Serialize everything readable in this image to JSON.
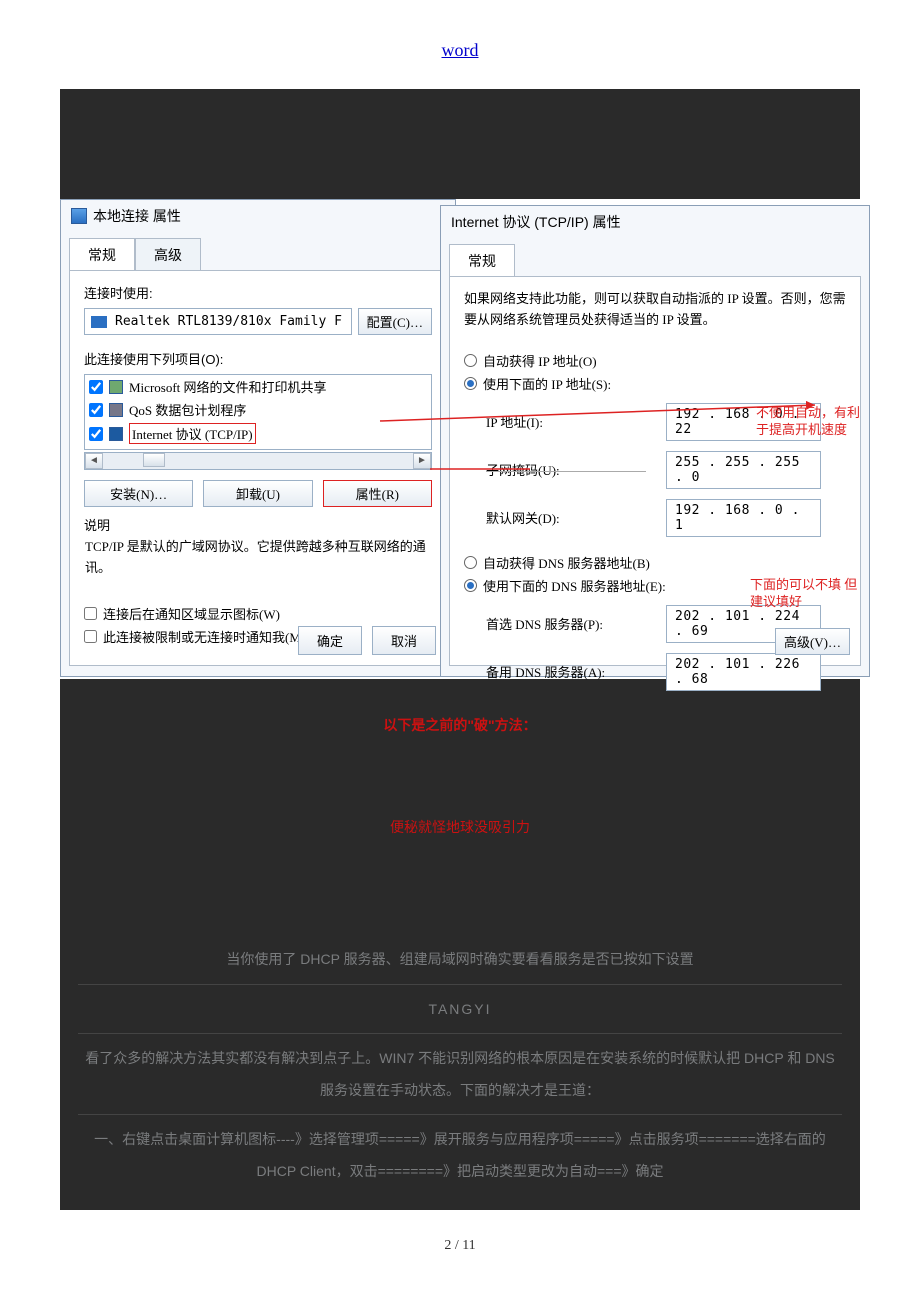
{
  "header": {
    "word_link": "word"
  },
  "dialog_left": {
    "title": "本地连接 属性",
    "tab_general": "常规",
    "tab_advanced": "高级",
    "connect_using": "连接时使用:",
    "adapter": "Realtek RTL8139/810x Family F",
    "configure_btn": "配置(C)…",
    "uses_items_label": "此连接使用下列项目(O):",
    "item1": "Microsoft 网络的文件和打印机共享",
    "item2": "QoS 数据包计划程序",
    "item3": "Internet 协议 (TCP/IP)",
    "install_btn": "安装(N)…",
    "uninstall_btn": "卸载(U)",
    "properties_btn": "属性(R)",
    "desc_label": "说明",
    "desc_text": "TCP/IP 是默认的广域网协议。它提供跨越多种互联网络的通讯。",
    "show_icon": "连接后在通知区域显示图标(W)",
    "notify_limited": "此连接被限制或无连接时通知我(M)",
    "ok_btn": "确定",
    "cancel_btn": "取消"
  },
  "dialog_right": {
    "title": "Internet 协议 (TCP/IP) 属性",
    "tab_general": "常规",
    "help_text": "如果网络支持此功能，则可以获取自动指派的 IP 设置。否则，您需要从网络系统管理员处获得适当的 IP 设置。",
    "auto_ip": "自动获得 IP 地址(O)",
    "use_ip": "使用下面的 IP 地址(S):",
    "ip_label": "IP 地址(I):",
    "ip_value": "192 . 168 .  0  . 22",
    "mask_label": "子网掩码(U):",
    "mask_value": "255 . 255 . 255 .  0",
    "gateway_label": "默认网关(D):",
    "gateway_value": "192 . 168 .  0  .  1",
    "auto_dns": "自动获得 DNS 服务器地址(B)",
    "use_dns": "使用下面的 DNS 服务器地址(E):",
    "dns1_label": "首选 DNS 服务器(P):",
    "dns1_value": "202 . 101 . 224 . 69",
    "dns2_label": "备用 DNS 服务器(A):",
    "dns2_value": "202 . 101 . 226 . 68",
    "advanced_btn": "高级(V)…",
    "anno_speed": "不使用自动，有利于提高开机速度",
    "anno_fill": "下面的可以不填 但建议填好"
  },
  "dark": {
    "heading": "以下是之前的\"破\"方法：",
    "red_quote": "便秘就怪地球没吸引力",
    "line_dhcp": "当你使用了 DHCP 服务器、组建局域网时确实要看看服务是否已按如下设置",
    "author": "TANGYI",
    "para1": "看了众多的解决方法其实都没有解决到点子上。WIN7 不能识别网络的根本原因是在安装系统的时候默认把 DHCP 和 DNS 服务设置在手动状态。下面的解决才是王道：",
    "step1": "一、右键点击桌面计算机图标----》选择管理项=====》展开服务与应用程序项=====》点击服务项=======选择右面的 DHCP Client，双击========》把启动类型更改为自动===》确定"
  },
  "footer": {
    "page": "2 / 11"
  }
}
